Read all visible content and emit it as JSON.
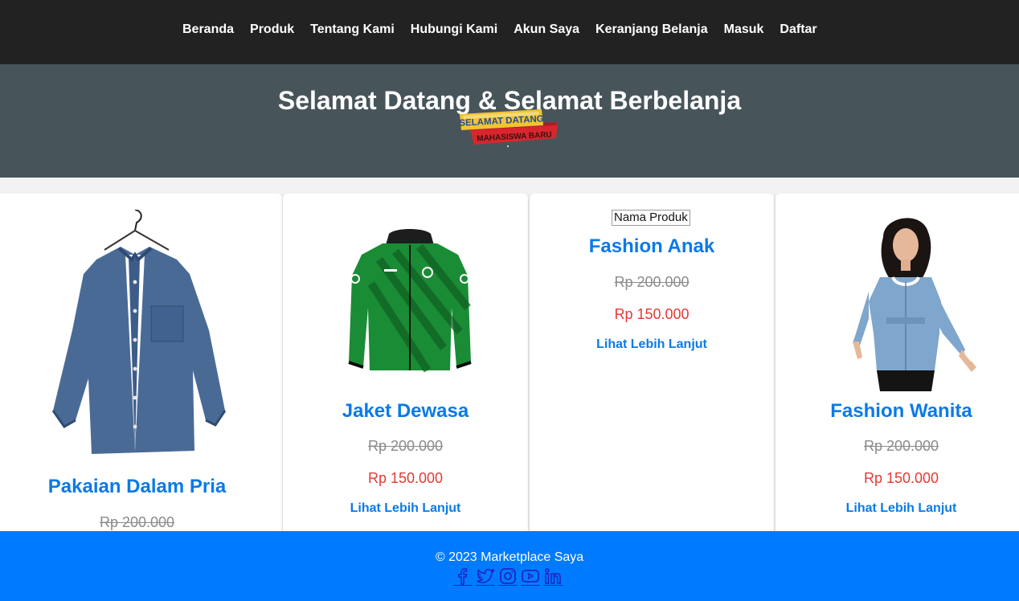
{
  "nav": {
    "items": [
      {
        "label": "Beranda"
      },
      {
        "label": "Produk"
      },
      {
        "label": "Tentang Kami"
      },
      {
        "label": "Hubungi Kami"
      },
      {
        "label": "Akun Saya"
      },
      {
        "label": "Keranjang Belanja"
      },
      {
        "label": "Masuk"
      },
      {
        "label": "Daftar"
      }
    ]
  },
  "hero": {
    "title": "Selamat Datang & Selamat Berbelanja",
    "badge_line1": "SELAMAT DATANG",
    "badge_line2": "MAHASISWA BARU"
  },
  "products": [
    {
      "name": "Pakaian Dalam Pria",
      "old_price": "Rp 200.000",
      "image": "denim-shirt-image"
    },
    {
      "name": "Jaket Dewasa",
      "old_price": "Rp 200.000",
      "new_price": "Rp 150.000",
      "more": "Lihat Lebih Lanjut",
      "image": "green-jacket-image"
    },
    {
      "name": "Fashion Anak",
      "alt": "Nama Produk",
      "old_price": "Rp 200.000",
      "new_price": "Rp 150.000",
      "more": "Lihat Lebih Lanjut"
    },
    {
      "name": "Fashion Wanita",
      "old_price": "Rp 200.000",
      "new_price": "Rp 150.000",
      "more": "Lihat Lebih Lanjut",
      "image": "denim-blouse-image"
    }
  ],
  "footer": {
    "copyright": "© 2023 Marketplace Saya",
    "social": [
      "facebook-icon",
      "twitter-icon",
      "instagram-icon",
      "youtube-icon",
      "linkedin-icon"
    ],
    "icon_color": "#1f27c4"
  },
  "colors": {
    "nav_bg": "#222222",
    "hero_bg": "#47555b",
    "accent": "#0a7ae8",
    "sale": "#e53935",
    "footer_bg": "#007bff"
  }
}
